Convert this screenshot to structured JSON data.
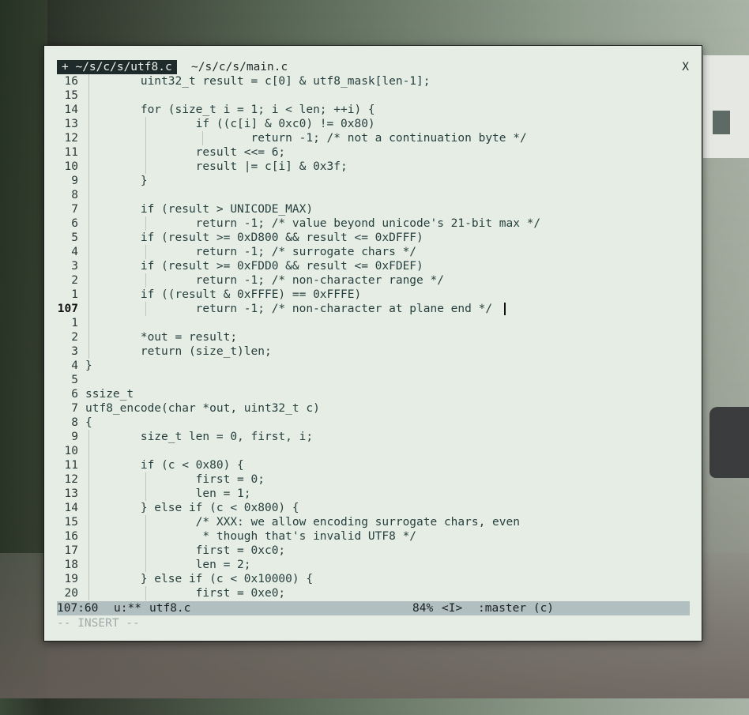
{
  "tabs": [
    {
      "label": "+ ~/s/c/s/utf8.c",
      "active": true
    },
    {
      "label": "~/s/c/s/main.c",
      "active": false
    }
  ],
  "close_label": "X",
  "lines": [
    {
      "num": "16",
      "text": "        uint32_t result = c[0] & utf8_mask[len-1];",
      "guides": [
        1
      ]
    },
    {
      "num": "15",
      "text": "",
      "guides": [
        1
      ]
    },
    {
      "num": "14",
      "text": "        for (size_t i = 1; i < len; ++i) {",
      "guides": [
        1
      ]
    },
    {
      "num": "13",
      "text": "                if ((c[i] & 0xc0) != 0x80)",
      "guides": [
        1,
        2
      ]
    },
    {
      "num": "12",
      "text": "                        return -1; /* not a continuation byte */",
      "guides": [
        1,
        2,
        3
      ]
    },
    {
      "num": "11",
      "text": "                result <<= 6;",
      "guides": [
        1,
        2
      ]
    },
    {
      "num": "10",
      "text": "                result |= c[i] & 0x3f;",
      "guides": [
        1,
        2
      ]
    },
    {
      "num": "9",
      "text": "        }",
      "guides": [
        1
      ]
    },
    {
      "num": "8",
      "text": "",
      "guides": [
        1
      ]
    },
    {
      "num": "7",
      "text": "        if (result > UNICODE_MAX)",
      "guides": [
        1
      ]
    },
    {
      "num": "6",
      "text": "                return -1; /* value beyond unicode's 21-bit max */",
      "guides": [
        1,
        2
      ]
    },
    {
      "num": "5",
      "text": "        if (result >= 0xD800 && result <= 0xDFFF)",
      "guides": [
        1
      ]
    },
    {
      "num": "4",
      "text": "                return -1; /* surrogate chars */",
      "guides": [
        1,
        2
      ]
    },
    {
      "num": "3",
      "text": "        if (result >= 0xFDD0 && result <= 0xFDEF)",
      "guides": [
        1
      ]
    },
    {
      "num": "2",
      "text": "                return -1; /* non-character range */",
      "guides": [
        1,
        2
      ]
    },
    {
      "num": "1",
      "text": "        if ((result & 0xFFFE) == 0xFFFE)",
      "guides": [
        1
      ]
    },
    {
      "num": "107",
      "text": "                return -1; /* non-character at plane end */",
      "guides": [
        1,
        2
      ],
      "current": true
    },
    {
      "num": "1",
      "text": "",
      "guides": [
        1
      ]
    },
    {
      "num": "2",
      "text": "        *out = result;",
      "guides": [
        1
      ]
    },
    {
      "num": "3",
      "text": "        return (size_t)len;",
      "guides": [
        1
      ]
    },
    {
      "num": "4",
      "text": "}",
      "guides": []
    },
    {
      "num": "5",
      "text": "",
      "guides": []
    },
    {
      "num": "6",
      "text": "ssize_t",
      "guides": []
    },
    {
      "num": "7",
      "text": "utf8_encode(char *out, uint32_t c)",
      "guides": []
    },
    {
      "num": "8",
      "text": "{",
      "guides": []
    },
    {
      "num": "9",
      "text": "        size_t len = 0, first, i;",
      "guides": [
        1
      ]
    },
    {
      "num": "10",
      "text": "",
      "guides": [
        1
      ]
    },
    {
      "num": "11",
      "text": "        if (c < 0x80) {",
      "guides": [
        1
      ]
    },
    {
      "num": "12",
      "text": "                first = 0;",
      "guides": [
        1,
        2
      ]
    },
    {
      "num": "13",
      "text": "                len = 1;",
      "guides": [
        1,
        2
      ]
    },
    {
      "num": "14",
      "text": "        } else if (c < 0x800) {",
      "guides": [
        1
      ]
    },
    {
      "num": "15",
      "text": "                /* XXX: we allow encoding surrogate chars, even",
      "guides": [
        1,
        2
      ]
    },
    {
      "num": "16",
      "text": "                 * though that's invalid UTF8 */",
      "guides": [
        1,
        2
      ]
    },
    {
      "num": "17",
      "text": "                first = 0xc0;",
      "guides": [
        1,
        2
      ]
    },
    {
      "num": "18",
      "text": "                len = 2;",
      "guides": [
        1,
        2
      ]
    },
    {
      "num": "19",
      "text": "        } else if (c < 0x10000) {",
      "guides": [
        1
      ]
    },
    {
      "num": "20",
      "text": "                first = 0xe0;",
      "guides": [
        1,
        2
      ]
    }
  ],
  "status": {
    "position": "107:60",
    "flags": "u:**",
    "filename": "utf8.c",
    "percent": "84%",
    "state": "<I>",
    "branch": ":master (c)"
  },
  "mode_line": "-- INSERT --"
}
